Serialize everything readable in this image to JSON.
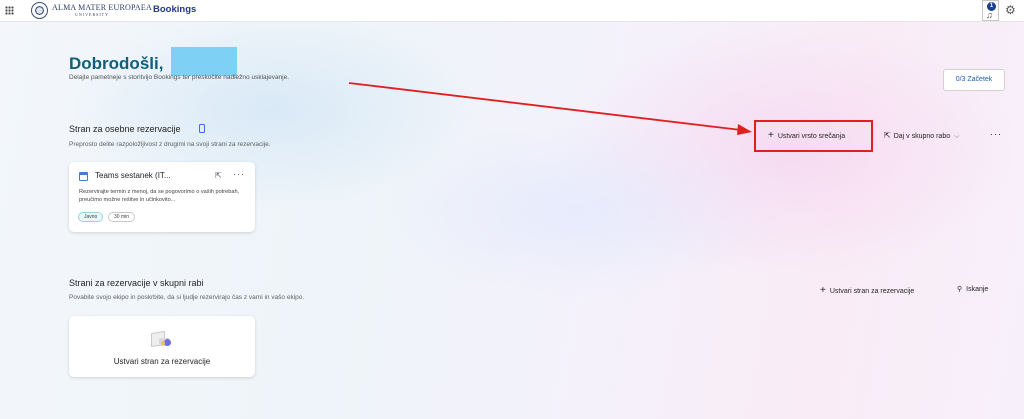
{
  "header": {
    "logo_text": "ALMA MATER EUROPAEA",
    "logo_sub": "UNIVERSITY",
    "app_title": "Bookings",
    "notification_count": "1"
  },
  "welcome": {
    "title": "Dobrodošli,",
    "subtitle": "Delajte pametneje s storitvijo Bookings ter preskočite nadležno usklajevanje.",
    "start_button": "0/3  Začetek"
  },
  "personal": {
    "title": "Stran za osebne rezervacije",
    "subtitle": "Preprosto delite razpoložljivost z drugimi na svoji strani za rezervacije.",
    "create_meeting_type": "Ustvari vrsto srečanja",
    "share": "Daj v skupno rabo",
    "more": "···",
    "card": {
      "title": "Teams sestanek (IT...",
      "description": "Rezervirajte termin z menoj, da se pogovorimo o vaših potrebah, preučimo možne rešitve in učinkovito...",
      "tag_public": "Javno",
      "tag_duration": "30 min"
    }
  },
  "shared": {
    "title": "Strani za rezervacije v skupni rabi",
    "subtitle": "Povabite svojo ekipo in poskrbite, da si ljudje rezervirajo čas z vami in vašo ekipo.",
    "create_page": "Ustvari stran za rezervacije",
    "search": "Iskanje",
    "empty_card_text": "Ustvari stran za rezervacije"
  },
  "colors": {
    "accent": "#0f5f7a",
    "annotation": "#e02020",
    "redaction": "#7fd0f5"
  }
}
